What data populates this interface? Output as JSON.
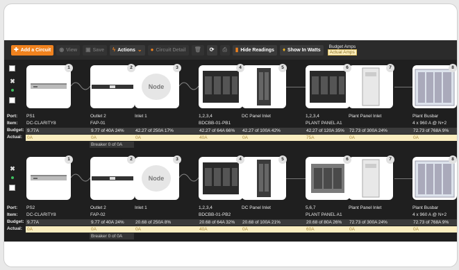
{
  "toolbar": {
    "add_circuit": "Add a Circuit",
    "view": "View",
    "save": "Save",
    "actions": "Actions",
    "circuit_detail": "Circuit Detail",
    "hide_readings": "Hide Readings",
    "show_in_watts": "Show In Watts",
    "budget_amps": "Budget Amps",
    "actual_amps": "Actual Amps"
  },
  "row_headers": {
    "port": "Port:",
    "item": "Item:",
    "budget": "Budget:",
    "actual": "Actual:"
  },
  "node_label": "Node",
  "circuits": [
    {
      "devices": [
        {
          "num": "1",
          "port": "PS1",
          "item": "DC-CLARITY8",
          "budget": "9.77A",
          "actual": "0A"
        },
        {
          "num": "2",
          "port": "Outlet 2",
          "item": "FAP-01",
          "budget": "9.77 of 40A  24%",
          "actual": "0A",
          "breaker": "Breaker 0 of 0A"
        },
        {
          "num": "3",
          "port": "Inlet 1",
          "item": "",
          "budget": "42.27 of 250A  17%",
          "actual": "0A"
        },
        {
          "num": "4",
          "port": "1,2,3,4",
          "item": "BDCBB-01-PB1",
          "budget": "42.27 of 64A  66%",
          "actual": "40A"
        },
        {
          "num": "5",
          "port": "DC Panel Inlet",
          "item": "",
          "budget": "42.27 of 100A  42%",
          "actual": "0A"
        },
        {
          "num": "6",
          "port": "1,2,3,4",
          "item": "PLANT PANEL A1",
          "budget": "42.27 of 120A  35%",
          "actual": "75A"
        },
        {
          "num": "7",
          "port": "Plant Panel Inlet",
          "item": "",
          "budget": "72.73 of 300A  24%",
          "actual": "0A"
        },
        {
          "num": "8",
          "port": "Plant Busbar",
          "item": "4 x 960 A @ N+2",
          "budget": "72.73 of 768A  9%",
          "actual": "0A"
        }
      ]
    },
    {
      "devices": [
        {
          "num": "1",
          "port": "PS2",
          "item": "DC-CLARITY8",
          "budget": "9.77A",
          "actual": "0A"
        },
        {
          "num": "2",
          "port": "Outlet 2",
          "item": "FAP-02",
          "budget": "9.77 of 40A  24%",
          "actual": "0A",
          "breaker": "Breaker 0 of 0A"
        },
        {
          "num": "3",
          "port": "Inlet 1",
          "item": "",
          "budget": "20.68 of 250A  8%",
          "actual": "0A"
        },
        {
          "num": "4",
          "port": "1,2,3,4",
          "item": "BDCBB-01-PB2",
          "budget": "20.68 of 64A  32%",
          "actual": "40A"
        },
        {
          "num": "5",
          "port": "DC Panel Inlet",
          "item": "",
          "budget": "20.68 of 100A  21%",
          "actual": "0A"
        },
        {
          "num": "6",
          "port": "5,6,7",
          "item": "PLANT PANEL A1",
          "budget": "20.68 of 80A  26%",
          "actual": "60A"
        },
        {
          "num": "7",
          "port": "Plant Panel Inlet",
          "item": "",
          "budget": "72.73 of 300A  24%",
          "actual": "0A"
        },
        {
          "num": "8",
          "port": "Plant Busbar",
          "item": "4 x 960 A @ N+2",
          "budget": "72.73 of 768A  9%",
          "actual": "0A"
        }
      ]
    }
  ],
  "colors": {
    "accent": "#f0821e",
    "actual_fill": "#fbeec0",
    "status_ok": "#3fbf5f"
  }
}
